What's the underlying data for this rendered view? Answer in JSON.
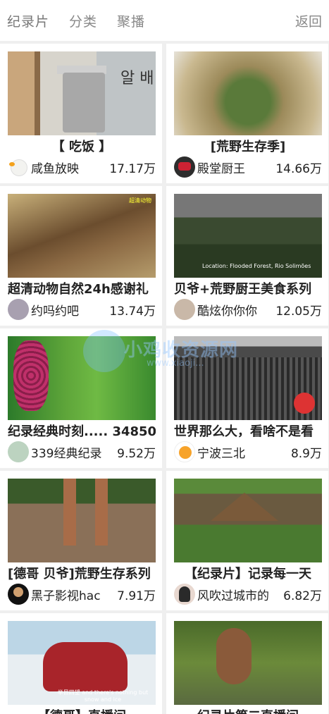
{
  "header": {
    "tabs": [
      {
        "label": "纪录片"
      },
      {
        "label": "分类"
      },
      {
        "label": "聚播"
      }
    ],
    "back_label": "返回"
  },
  "videos": [
    {
      "title": "【 吃饭 】",
      "author": "咸鱼放映",
      "views": "17.17万",
      "avatar": "duck-avatar"
    },
    {
      "title": "[荒野生存季]",
      "author": "殿堂厨王",
      "views": "14.66万",
      "avatar": "cake-avatar"
    },
    {
      "title": "超清动物自然24h感谢礼",
      "author": "约吗约吧",
      "views": "13.74万",
      "avatar": "person-avatar"
    },
    {
      "title": "贝爷+荒野厨王美食系列",
      "author": "酷炫你你你",
      "views": "12.05万",
      "avatar": "animal-avatar"
    },
    {
      "title": "纪录经典时刻..... 34850",
      "author": "339经典纪录",
      "views": "9.52万",
      "avatar": "landscape-avatar"
    },
    {
      "title": "世界那么大，看啥不是看",
      "author": "宁波三北",
      "views": "8.9万",
      "avatar": "cartoon-avatar"
    },
    {
      "title": "[德哥 贝爷]荒野生存系列",
      "author": "黑子影视hac",
      "views": "7.91万",
      "avatar": "dark-avatar"
    },
    {
      "title": "【纪录片】记录每一天",
      "author": "风吹过城市的",
      "views": "6.82万",
      "avatar": "girl-avatar"
    },
    {
      "title": "【德哥】直播间",
      "author": "",
      "views": "",
      "avatar": ""
    },
    {
      "title": "纪录片第二直播间",
      "author": "",
      "views": "",
      "avatar": ""
    }
  ],
  "thumb_text": {
    "t1": "알 배",
    "t3": "超清动物",
    "t4": "Location: Flooded Forest, Rio Solimões",
    "t9": "举目四望 and there's nothing but snow and ice"
  },
  "watermark": {
    "text": "小鸡收资源网",
    "sub": "www.xiaoji..."
  }
}
